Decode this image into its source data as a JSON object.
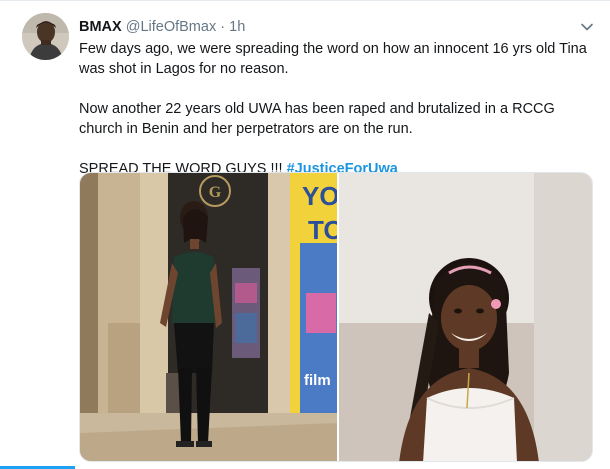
{
  "tweet": {
    "display_name": "BMAX",
    "handle": "@LifeOfBmax",
    "separator": "·",
    "time": "1h",
    "paragraphs": [
      "Few days ago, we were spreading the word on how an innocent 16 yrs old Tina was shot in Lagos for no reason.",
      "Now another 22 years old UWA has been raped and brutalized in a RCCG church in Benin and her perpetrators are on the run."
    ],
    "final_line_text": "SPREAD THE WORD GUYS !!! ",
    "hashtag": "#JusticeForUwa"
  },
  "media": {
    "left_photo": {
      "poster_text_1": "YOU",
      "poster_text_2": "TO",
      "poster_text_3": "film",
      "logo_letter": "G"
    },
    "right_photo": {}
  },
  "icons": {
    "menu": "chevron-down-icon"
  },
  "colors": {
    "accent": "#1da1f2",
    "hashtag": "#1b95e0",
    "text": "#14171a",
    "muted": "#657786"
  }
}
